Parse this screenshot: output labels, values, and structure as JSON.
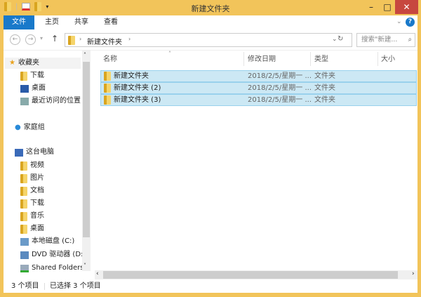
{
  "window": {
    "title": "新建文件夹",
    "controls": {
      "minimize": "–",
      "maximize": "□",
      "close": "✕"
    }
  },
  "ribbon": {
    "tabs": [
      "文件",
      "主页",
      "共享",
      "查看"
    ]
  },
  "address": {
    "path": "新建文件夹",
    "search_placeholder": "搜索\"新建...",
    "refresh": "↻"
  },
  "nav": {
    "favorites": {
      "label": "收藏夹",
      "items": [
        "下载",
        "桌面",
        "最近访问的位置"
      ]
    },
    "homegroup": "家庭组",
    "pc": {
      "label": "这台电脑",
      "items": [
        "视频",
        "图片",
        "文档",
        "下载",
        "音乐",
        "桌面",
        "本地磁盘 (C:)",
        "DVD 驱动器 (D:)",
        "Shared Folders"
      ]
    }
  },
  "columns": [
    "名称",
    "修改日期",
    "类型",
    "大小"
  ],
  "files": [
    {
      "name": "新建文件夹",
      "date": "2018/2/5/星期一 ...",
      "type": "文件夹"
    },
    {
      "name": "新建文件夹 (2)",
      "date": "2018/2/5/星期一 ...",
      "type": "文件夹"
    },
    {
      "name": "新建文件夹 (3)",
      "date": "2018/2/5/星期一 ...",
      "type": "文件夹"
    }
  ],
  "status": {
    "count": "3 个项目",
    "selected": "已选择 3 个项目"
  },
  "colors": {
    "frame": "#f2c45a",
    "file_tab": "#1979ca",
    "selection": "#cce8f4"
  }
}
